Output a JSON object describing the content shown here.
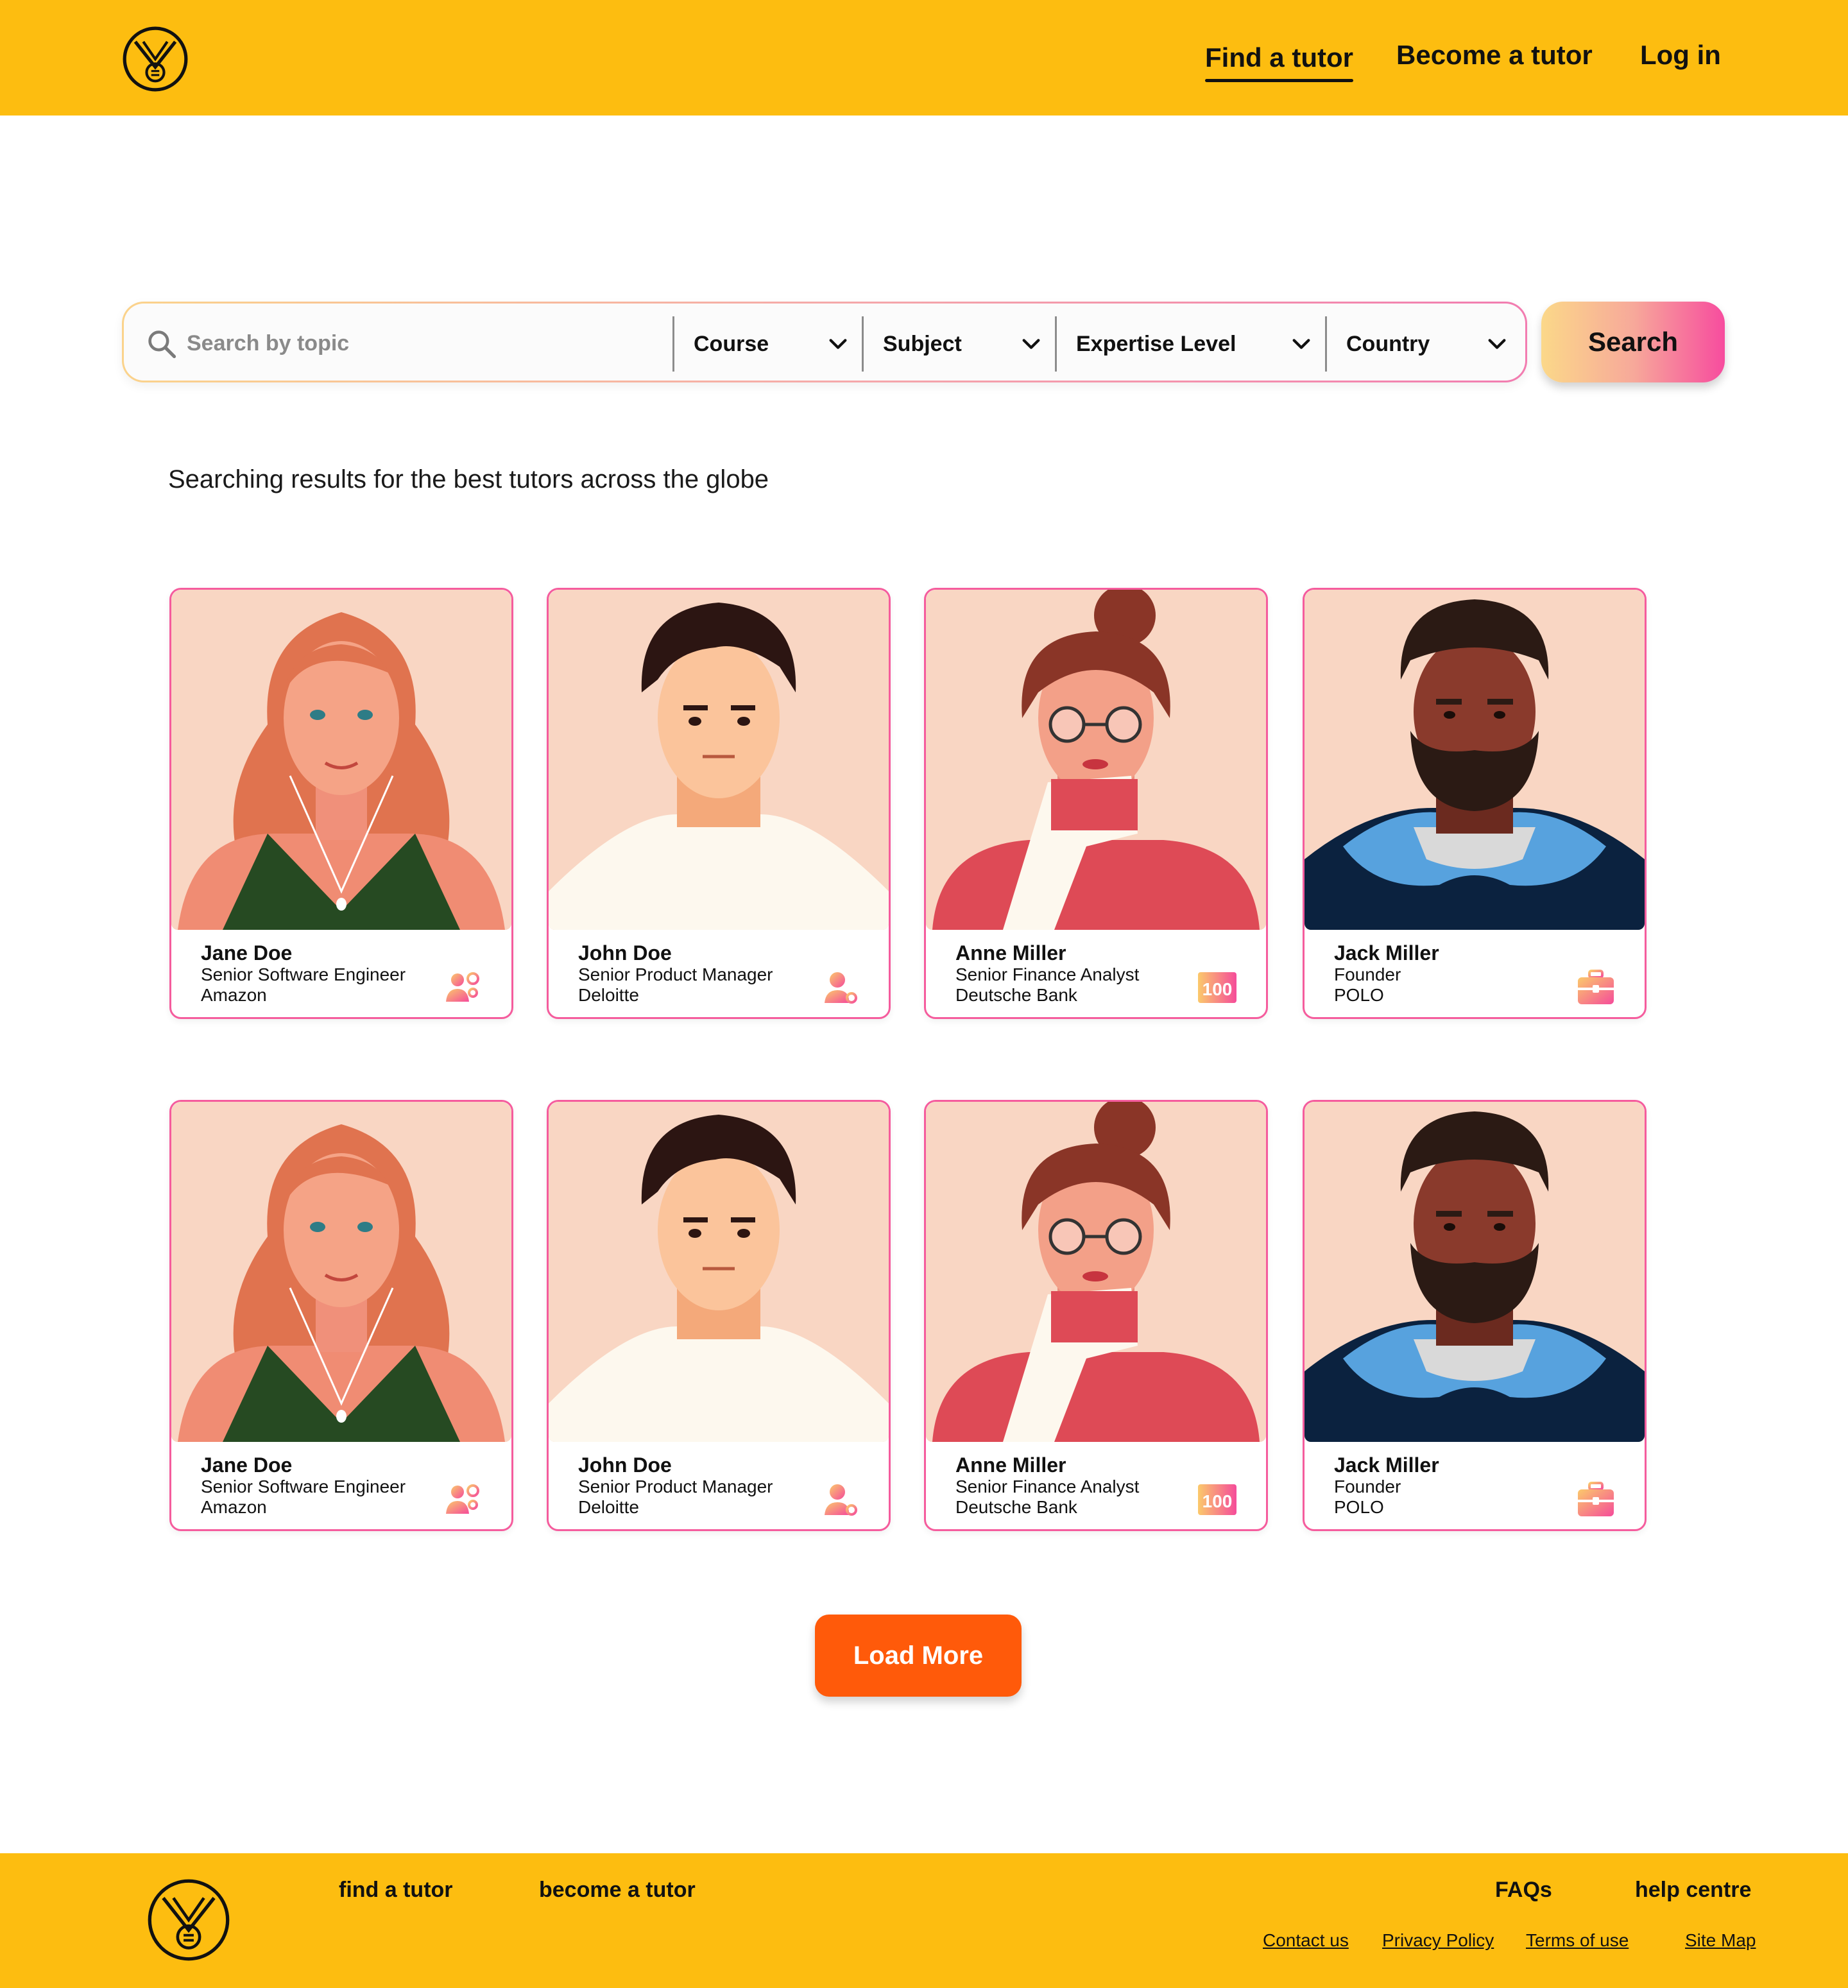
{
  "header": {
    "logo_icon": "medal-logo-icon",
    "nav": [
      {
        "label": "Find a tutor",
        "active": true
      },
      {
        "label": "Become a tutor",
        "active": false
      },
      {
        "label": "Log in",
        "active": false
      }
    ]
  },
  "search": {
    "placeholder": "Search by topic",
    "value": "",
    "filters": [
      {
        "label": "Course"
      },
      {
        "label": "Subject"
      },
      {
        "label": "Expertise Level"
      },
      {
        "label": "Country"
      }
    ],
    "button_label": "Search",
    "button_gradient": [
      "#FBD889",
      "#F74C9E"
    ]
  },
  "results_heading": "Searching results for the best tutors across the globe",
  "tutors": [
    {
      "name": "Jane Doe",
      "role": "Senior Software Engineer",
      "company": "Amazon",
      "badge_icon": "team-settings-icon"
    },
    {
      "name": "John Doe",
      "role": "Senior Product Manager",
      "company": "Deloitte",
      "badge_icon": "user-settings-icon"
    },
    {
      "name": "Anne Miller",
      "role": "Senior Finance Analyst",
      "company": "Deutsche Bank",
      "badge_icon": "score-100-icon",
      "badge_text": "100"
    },
    {
      "name": "Jack Miller",
      "role": " Founder",
      "company": "POLO",
      "badge_icon": "briefcase-icon"
    },
    {
      "name": "Jane Doe",
      "role": "Senior Software Engineer",
      "company": "Amazon",
      "badge_icon": "team-settings-icon"
    },
    {
      "name": "John Doe",
      "role": "Senior Product Manager",
      "company": "Deloitte",
      "badge_icon": "user-settings-icon"
    },
    {
      "name": "Anne Miller",
      "role": "Senior Finance Analyst",
      "company": "Deutsche Bank",
      "badge_icon": "score-100-icon",
      "badge_text": "100"
    },
    {
      "name": "Jack Miller",
      "role": " Founder",
      "company": "POLO",
      "badge_icon": "briefcase-icon"
    }
  ],
  "load_more_label": "Load More",
  "footer": {
    "links": [
      "find a tutor",
      "become a tutor",
      "FAQs",
      "help centre"
    ],
    "small_links": [
      "Contact us",
      "Privacy Policy",
      "Terms of use",
      "Site Map"
    ]
  },
  "colors": {
    "brand_yellow": "#FDBD10",
    "accent_pink": "#F55C9D",
    "load_more_orange": "#FF5A0A",
    "portrait_bg": "#F9D6C3"
  }
}
